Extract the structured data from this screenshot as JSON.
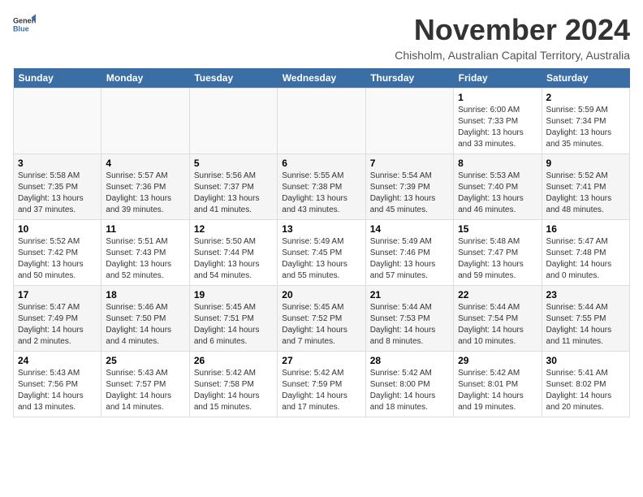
{
  "header": {
    "logo_general": "General",
    "logo_blue": "Blue",
    "month_title": "November 2024",
    "location": "Chisholm, Australian Capital Territory, Australia"
  },
  "calendar": {
    "weekdays": [
      "Sunday",
      "Monday",
      "Tuesday",
      "Wednesday",
      "Thursday",
      "Friday",
      "Saturday"
    ],
    "weeks": [
      [
        {
          "day": "",
          "info": ""
        },
        {
          "day": "",
          "info": ""
        },
        {
          "day": "",
          "info": ""
        },
        {
          "day": "",
          "info": ""
        },
        {
          "day": "",
          "info": ""
        },
        {
          "day": "1",
          "info": "Sunrise: 6:00 AM\nSunset: 7:33 PM\nDaylight: 13 hours\nand 33 minutes."
        },
        {
          "day": "2",
          "info": "Sunrise: 5:59 AM\nSunset: 7:34 PM\nDaylight: 13 hours\nand 35 minutes."
        }
      ],
      [
        {
          "day": "3",
          "info": "Sunrise: 5:58 AM\nSunset: 7:35 PM\nDaylight: 13 hours\nand 37 minutes."
        },
        {
          "day": "4",
          "info": "Sunrise: 5:57 AM\nSunset: 7:36 PM\nDaylight: 13 hours\nand 39 minutes."
        },
        {
          "day": "5",
          "info": "Sunrise: 5:56 AM\nSunset: 7:37 PM\nDaylight: 13 hours\nand 41 minutes."
        },
        {
          "day": "6",
          "info": "Sunrise: 5:55 AM\nSunset: 7:38 PM\nDaylight: 13 hours\nand 43 minutes."
        },
        {
          "day": "7",
          "info": "Sunrise: 5:54 AM\nSunset: 7:39 PM\nDaylight: 13 hours\nand 45 minutes."
        },
        {
          "day": "8",
          "info": "Sunrise: 5:53 AM\nSunset: 7:40 PM\nDaylight: 13 hours\nand 46 minutes."
        },
        {
          "day": "9",
          "info": "Sunrise: 5:52 AM\nSunset: 7:41 PM\nDaylight: 13 hours\nand 48 minutes."
        }
      ],
      [
        {
          "day": "10",
          "info": "Sunrise: 5:52 AM\nSunset: 7:42 PM\nDaylight: 13 hours\nand 50 minutes."
        },
        {
          "day": "11",
          "info": "Sunrise: 5:51 AM\nSunset: 7:43 PM\nDaylight: 13 hours\nand 52 minutes."
        },
        {
          "day": "12",
          "info": "Sunrise: 5:50 AM\nSunset: 7:44 PM\nDaylight: 13 hours\nand 54 minutes."
        },
        {
          "day": "13",
          "info": "Sunrise: 5:49 AM\nSunset: 7:45 PM\nDaylight: 13 hours\nand 55 minutes."
        },
        {
          "day": "14",
          "info": "Sunrise: 5:49 AM\nSunset: 7:46 PM\nDaylight: 13 hours\nand 57 minutes."
        },
        {
          "day": "15",
          "info": "Sunrise: 5:48 AM\nSunset: 7:47 PM\nDaylight: 13 hours\nand 59 minutes."
        },
        {
          "day": "16",
          "info": "Sunrise: 5:47 AM\nSunset: 7:48 PM\nDaylight: 14 hours\nand 0 minutes."
        }
      ],
      [
        {
          "day": "17",
          "info": "Sunrise: 5:47 AM\nSunset: 7:49 PM\nDaylight: 14 hours\nand 2 minutes."
        },
        {
          "day": "18",
          "info": "Sunrise: 5:46 AM\nSunset: 7:50 PM\nDaylight: 14 hours\nand 4 minutes."
        },
        {
          "day": "19",
          "info": "Sunrise: 5:45 AM\nSunset: 7:51 PM\nDaylight: 14 hours\nand 6 minutes."
        },
        {
          "day": "20",
          "info": "Sunrise: 5:45 AM\nSunset: 7:52 PM\nDaylight: 14 hours\nand 7 minutes."
        },
        {
          "day": "21",
          "info": "Sunrise: 5:44 AM\nSunset: 7:53 PM\nDaylight: 14 hours\nand 8 minutes."
        },
        {
          "day": "22",
          "info": "Sunrise: 5:44 AM\nSunset: 7:54 PM\nDaylight: 14 hours\nand 10 minutes."
        },
        {
          "day": "23",
          "info": "Sunrise: 5:44 AM\nSunset: 7:55 PM\nDaylight: 14 hours\nand 11 minutes."
        }
      ],
      [
        {
          "day": "24",
          "info": "Sunrise: 5:43 AM\nSunset: 7:56 PM\nDaylight: 14 hours\nand 13 minutes."
        },
        {
          "day": "25",
          "info": "Sunrise: 5:43 AM\nSunset: 7:57 PM\nDaylight: 14 hours\nand 14 minutes."
        },
        {
          "day": "26",
          "info": "Sunrise: 5:42 AM\nSunset: 7:58 PM\nDaylight: 14 hours\nand 15 minutes."
        },
        {
          "day": "27",
          "info": "Sunrise: 5:42 AM\nSunset: 7:59 PM\nDaylight: 14 hours\nand 17 minutes."
        },
        {
          "day": "28",
          "info": "Sunrise: 5:42 AM\nSunset: 8:00 PM\nDaylight: 14 hours\nand 18 minutes."
        },
        {
          "day": "29",
          "info": "Sunrise: 5:42 AM\nSunset: 8:01 PM\nDaylight: 14 hours\nand 19 minutes."
        },
        {
          "day": "30",
          "info": "Sunrise: 5:41 AM\nSunset: 8:02 PM\nDaylight: 14 hours\nand 20 minutes."
        }
      ]
    ]
  }
}
